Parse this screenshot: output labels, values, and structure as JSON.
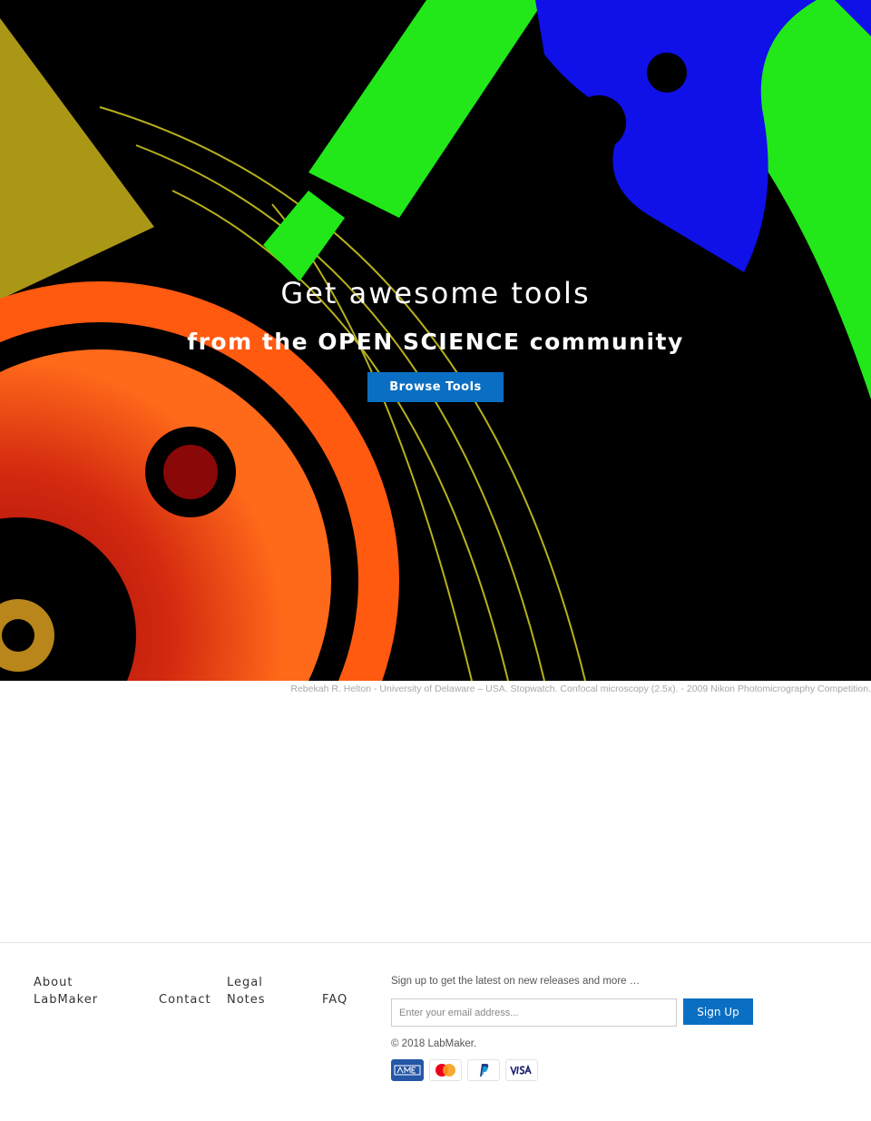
{
  "hero": {
    "title": "Get awesome tools",
    "subtitle": "from the OPEN SCIENCE community",
    "button_label": "Browse Tools"
  },
  "image_credit": "Rebekah R. Helton - University of Delaware – USA. Stopwatch. Confocal microscopy (2.5x). - 2009 Nikon Photomicrography Competition.",
  "footer": {
    "links": [
      "About LabMaker",
      "Contact",
      "Legal Notes",
      "FAQ"
    ],
    "signup_text": "Sign up to get the latest on new releases and more …",
    "email_placeholder": "Enter your email address...",
    "signup_button": "Sign Up",
    "copyright": "© 2018 LabMaker.",
    "payment_icons": [
      "amex-icon",
      "mastercard-icon",
      "paypal-icon",
      "visa-icon"
    ]
  },
  "colors": {
    "accent": "#0a6fc2",
    "hero_bg": "#000000"
  }
}
